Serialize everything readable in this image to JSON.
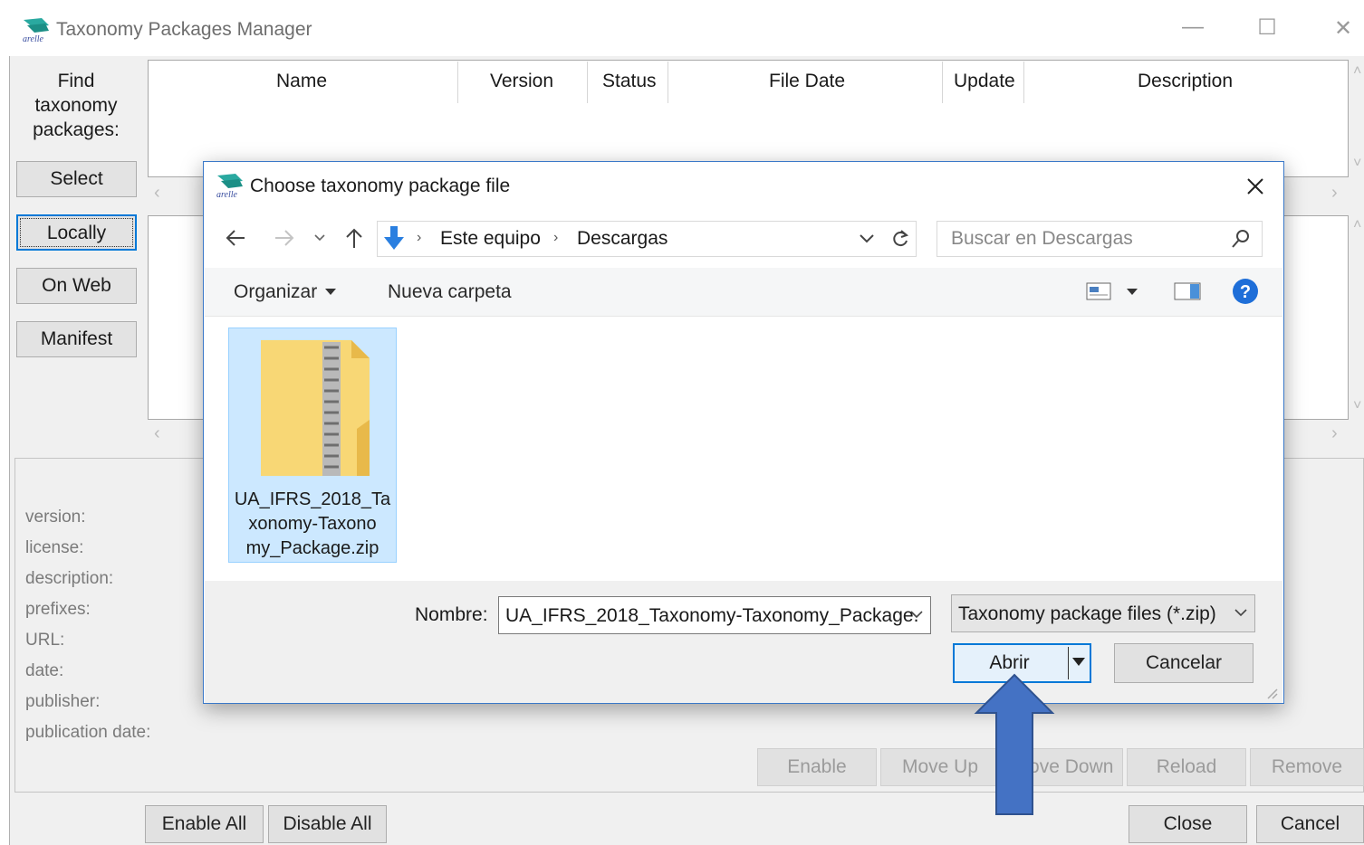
{
  "window": {
    "title": "Taxonomy Packages Manager",
    "logo_text": "arelle",
    "minimize_glyph": "—",
    "maximize_glyph": "☐",
    "close_glyph": "✕"
  },
  "sidebar": {
    "find_label": "Find taxonomy packages:",
    "buttons": [
      "Select",
      "Locally",
      "On Web",
      "Manifest"
    ]
  },
  "table": {
    "columns": [
      "Name",
      "Version",
      "Status",
      "File Date",
      "Update",
      "Description"
    ]
  },
  "details": {
    "labels": [
      "version:",
      "license:",
      "description:",
      "prefixes:",
      "URL:",
      "date:",
      "publisher:",
      "publication date:"
    ]
  },
  "actions": {
    "row_buttons": [
      "Enable",
      "Move Up",
      "Move Down",
      "Reload",
      "Remove"
    ],
    "enable_all": "Enable All",
    "disable_all": "Disable All",
    "close": "Close",
    "cancel": "Cancel"
  },
  "dialog": {
    "title": "Choose taxonomy package file",
    "breadcrumb": [
      "Este equipo",
      "Descargas"
    ],
    "search_placeholder": "Buscar en Descargas",
    "organize_label": "Organizar",
    "new_folder_label": "Nueva carpeta",
    "file": {
      "name": "UA_IFRS_2018_Taxonomy-Taxonomy_Package.zip",
      "name_lines": [
        "UA_IFRS_2018_Ta",
        "xonomy-Taxono",
        "my_Package.zip"
      ]
    },
    "filename_label": "Nombre:",
    "filename_value": "UA_IFRS_2018_Taxonomy-Taxonomy_Package.",
    "filetype_value": "Taxonomy package files (*.zip)",
    "open_label": "Abrir",
    "cancel_label": "Cancelar"
  },
  "colors": {
    "accent": "#0078d7",
    "arrow": "#4472c4",
    "arrow_border": "#2f528f",
    "selection": "#cce8ff",
    "folder": "#f8d775"
  }
}
